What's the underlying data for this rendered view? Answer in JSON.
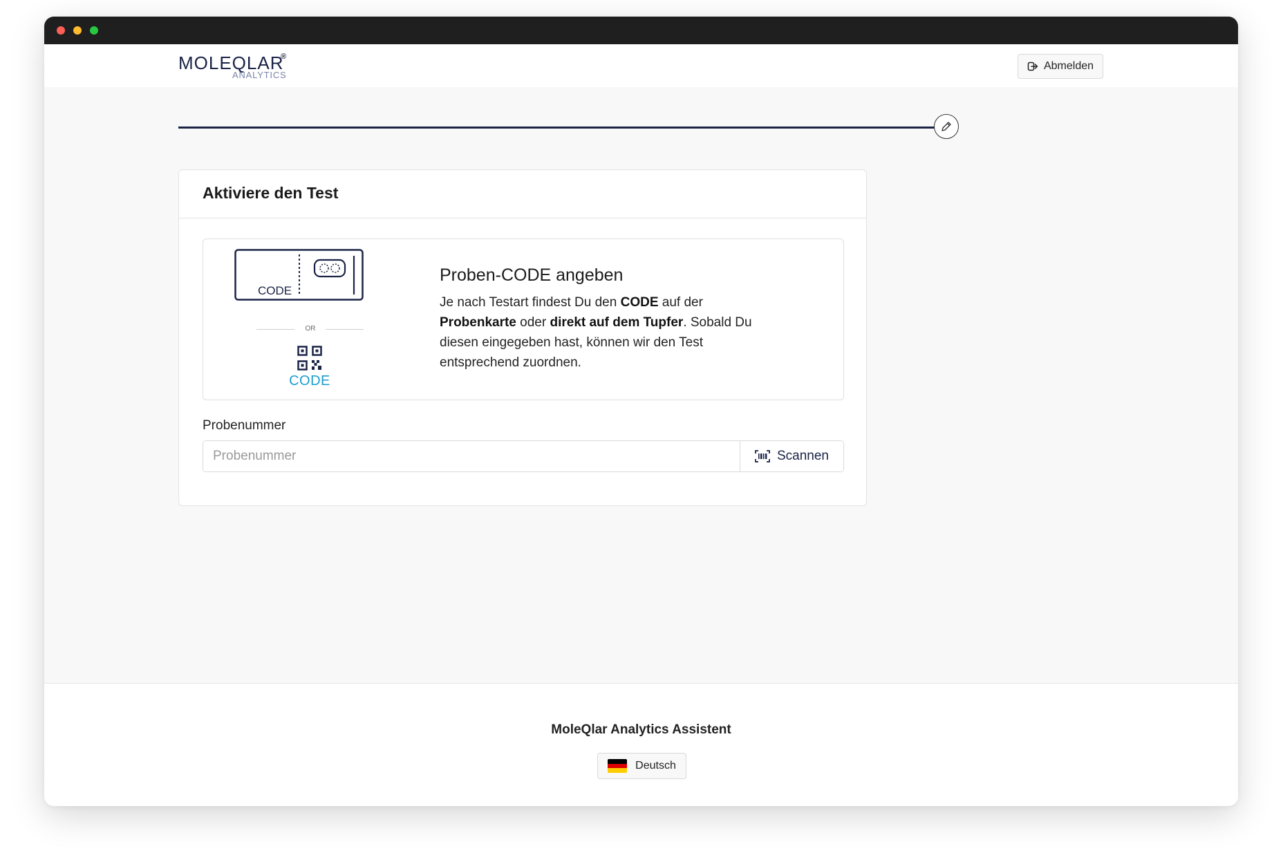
{
  "navbar": {
    "logo_main": "MOLEQLAR",
    "logo_sub": "ANALYTICS",
    "logo_reg": "®",
    "logout_label": "Abmelden",
    "logout_icon": "logout-icon"
  },
  "progress": {
    "value": 1.0,
    "end_icon": "pencil-icon"
  },
  "card": {
    "title": "Aktiviere den Test",
    "illustration": {
      "card_code_label": "CODE",
      "or_label": "OR",
      "qr_code_label": "CODE",
      "qr_icon": "qr-code-icon"
    },
    "info": {
      "heading": "Proben-CODE angeben",
      "text_1": "Je nach Testart findest Du den ",
      "bold_1": "CODE",
      "text_2": " auf der ",
      "bold_2": "Probenkarte",
      "text_3": " oder ",
      "bold_3": "direkt auf dem Tupfer",
      "text_4": ". Sobald Du diesen eingegeben hast, können wir den Test entsprechend zuordnen."
    },
    "field": {
      "label": "Probenummer",
      "placeholder": "Probenummer",
      "value": "",
      "scan_label": "Scannen",
      "scan_icon": "barcode-scan-icon"
    }
  },
  "footer": {
    "title": "MoleQlar Analytics Assistent",
    "language_label": "Deutsch",
    "flag_colors": [
      "#000000",
      "#dd0000",
      "#ffce00"
    ]
  },
  "colors": {
    "brand_navy": "#1a2346",
    "accent_blue": "#1a9ccf"
  }
}
